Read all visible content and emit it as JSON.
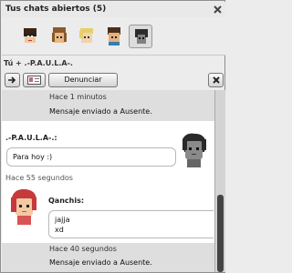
{
  "header": {
    "title": "Tus chats abiertos (5)"
  },
  "chat": {
    "with_label": "Tú + .-P.A.U.L.A-."
  },
  "toolbar": {
    "report_label": "Denunciar"
  },
  "avatars": [
    {
      "name": "avatar-1",
      "selected": false
    },
    {
      "name": "avatar-2",
      "selected": false
    },
    {
      "name": "avatar-3",
      "selected": false
    },
    {
      "name": "avatar-4",
      "selected": false
    },
    {
      "name": "avatar-5",
      "selected": true
    }
  ],
  "messages": {
    "sys1_time": "Hace 1 minutos",
    "sys1_text": "Mensaje enviado a Ausente.",
    "paula_name": ".-P.A.U.L.A-.:",
    "paula_text": "Para hoy :)",
    "paula_time": "Hace 55 segundos",
    "me_name": "Qanchis:",
    "me_line1": "jajja",
    "me_line2": "xd",
    "me_time": "Hace 40 segundos",
    "sys2_text": "Mensaje enviado a Ausente."
  },
  "colors": {
    "panel_bg": "#ececec",
    "log_bg": "#ffffff",
    "system_row_bg": "#dedede",
    "scroll_thumb": "#444444"
  }
}
